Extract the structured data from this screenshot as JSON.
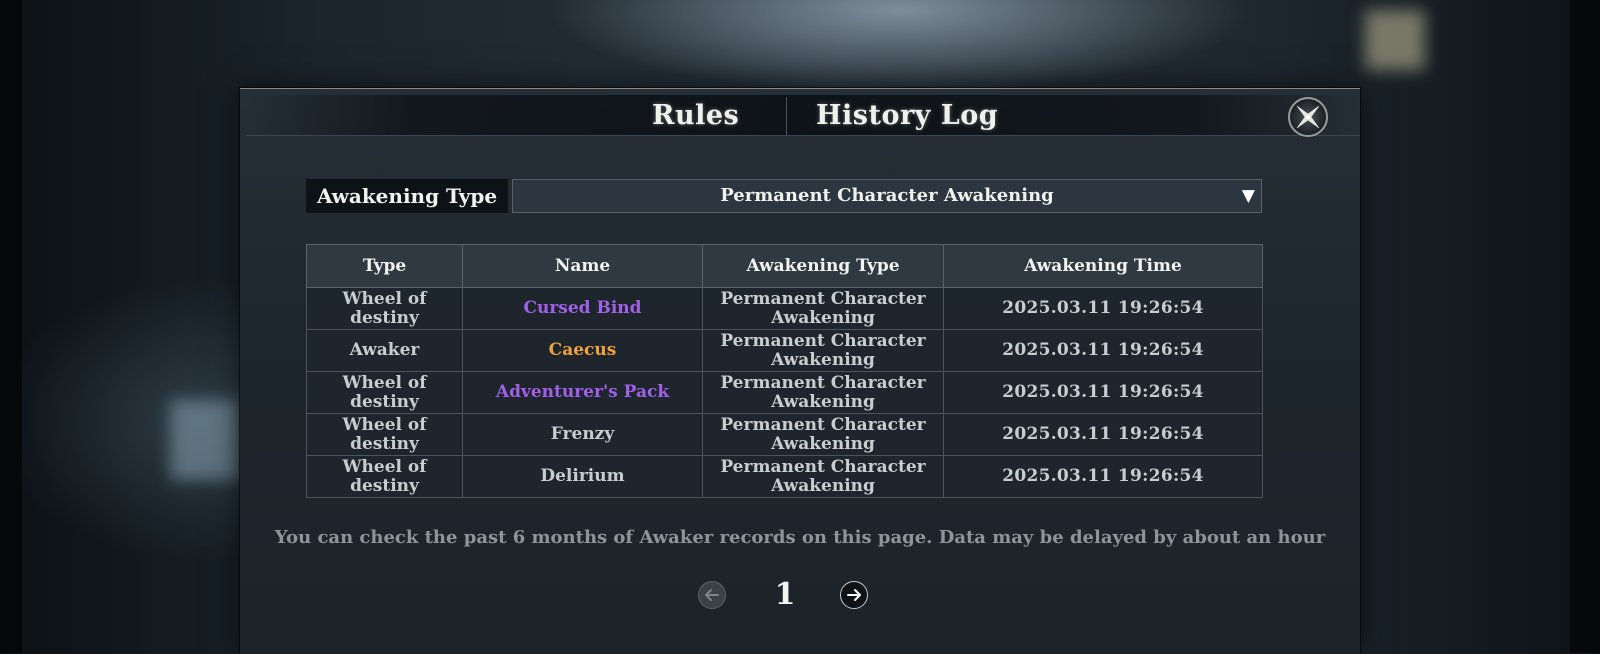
{
  "dialog": {
    "tabs": {
      "rules": "Rules",
      "history": "History Log"
    }
  },
  "filter": {
    "label": "Awakening Type",
    "selected": "Permanent Character Awakening",
    "arrow": "▼"
  },
  "table": {
    "headers": [
      "Type",
      "Name",
      "Awakening Type",
      "Awakening Time"
    ],
    "rows": [
      {
        "type": "Wheel of destiny",
        "name": "Cursed Bind",
        "name_color": "#a160e8",
        "awakening_type": "Permanent Character Awakening",
        "time": "2025.03.11 19:26:54"
      },
      {
        "type": "Awaker",
        "name": "Caecus",
        "name_color": "#f2a23a",
        "awakening_type": "Permanent Character Awakening",
        "time": "2025.03.11 19:26:54"
      },
      {
        "type": "Wheel of destiny",
        "name": "Adventurer's Pack",
        "name_color": "#a160e8",
        "awakening_type": "Permanent Character Awakening",
        "time": "2025.03.11 19:26:54"
      },
      {
        "type": "Wheel of destiny",
        "name": "Frenzy",
        "name_color": "#c9cdcf",
        "awakening_type": "Permanent Character Awakening",
        "time": "2025.03.11 19:26:54"
      },
      {
        "type": "Wheel of destiny",
        "name": "Delirium",
        "name_color": "#c9cdcf",
        "awakening_type": "Permanent Character Awakening",
        "time": "2025.03.11 19:26:54"
      }
    ]
  },
  "note": "You can check the past 6 months of Awaker records on this page. Data may be delayed by about an hour",
  "pager": {
    "current_page": "1"
  },
  "icons": {
    "close": "close-icon",
    "prev": "arrow-left-icon",
    "next": "arrow-right-icon",
    "dropdown": "chevron-down-icon"
  }
}
